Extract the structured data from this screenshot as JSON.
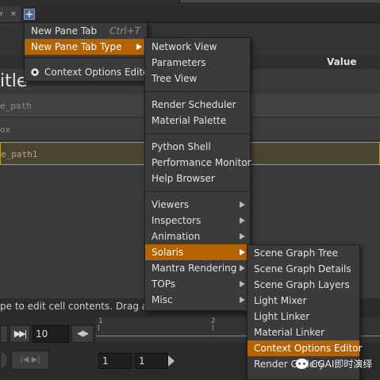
{
  "tab_bar": {
    "fragment_label": "r",
    "close_glyph": "×",
    "add_tab_glyph": "+"
  },
  "table": {
    "value_header": "Value",
    "title_fragment": "itle",
    "rows": [
      "e_path",
      "ox",
      "e_path1"
    ]
  },
  "hint": "pe to edit cell contents. Drag a row to reorder the list.",
  "playbar": {
    "play_glyph": "▶",
    "end_glyph": "▶▶|",
    "step_glyph": "◀|▶",
    "prev_key_glyph": "|◀ ▶|",
    "current_frame": "10",
    "tick_1": "1",
    "tick_2": "2",
    "range_start": "1",
    "range_end": "1"
  },
  "menu_main": {
    "items": [
      {
        "label": "New Pane Tab",
        "shortcut": "Ctrl+T"
      },
      {
        "label": "New Pane Tab Type",
        "highlighted": true,
        "submenu": true
      },
      {
        "label": "Context Options Editor",
        "radio": true
      }
    ]
  },
  "menu_types": {
    "items": [
      "Network View",
      "Parameters",
      "Tree View",
      "Render Scheduler",
      "Material Palette",
      "Python Shell",
      "Performance Monitor",
      "Help Browser",
      "Viewers",
      "Inspectors",
      "Animation",
      "Solaris",
      "Mantra Rendering",
      "TOPs",
      "Misc"
    ],
    "highlighted": "Solaris"
  },
  "menu_solaris": {
    "items": [
      "Scene Graph Tree",
      "Scene Graph Details",
      "Scene Graph Layers",
      "Light Mixer",
      "Light Linker",
      "Material Linker",
      "Context Options Editor",
      "Render Gallery"
    ],
    "highlighted": "Context Options Editor"
  },
  "watermark": "CGAI即时演绎",
  "colors": {
    "menu_highlight": "#b56200",
    "menu_bg": "#3b3b3b",
    "selected_row_border": "#c49a1a"
  }
}
